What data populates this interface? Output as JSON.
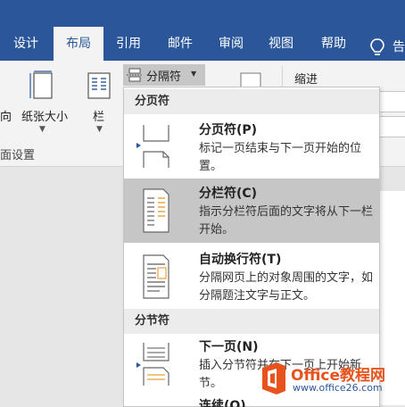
{
  "ribbon": {
    "tabs": [
      "设计",
      "布局",
      "引用",
      "邮件",
      "审阅",
      "视图",
      "帮助"
    ],
    "active_tab": "布局",
    "tell_me_partial": "告",
    "buttons": {
      "orientation_partial": "向",
      "size": "纸张大小",
      "columns": "栏",
      "breaks": "分隔符",
      "indent": "缩进"
    },
    "group_label": "面设置"
  },
  "menu": {
    "page_breaks_header": "分页符",
    "section_breaks_header": "分节符",
    "items": [
      {
        "title": "分页符(P)",
        "desc": "标记一页结束与下一页开始的位置。"
      },
      {
        "title": "分栏符(C)",
        "desc": "指示分栏符后面的文字将从下一栏开始。"
      },
      {
        "title": "自动换行符(T)",
        "desc": "分隔网页上的对象周围的文字，如分隔题注文字与正文。"
      },
      {
        "title": "下一页(N)",
        "desc": "插入分节符并在下一页上开始新节。"
      },
      {
        "title": "连续(O)",
        "desc": ""
      }
    ]
  },
  "watermark": {
    "brand": "Office教程网",
    "url": "www.office26.com"
  },
  "colors": {
    "ribbon_blue": "#2b579a",
    "menu_highlight": "#c6c6c6",
    "office_orange": "#e8531d"
  }
}
